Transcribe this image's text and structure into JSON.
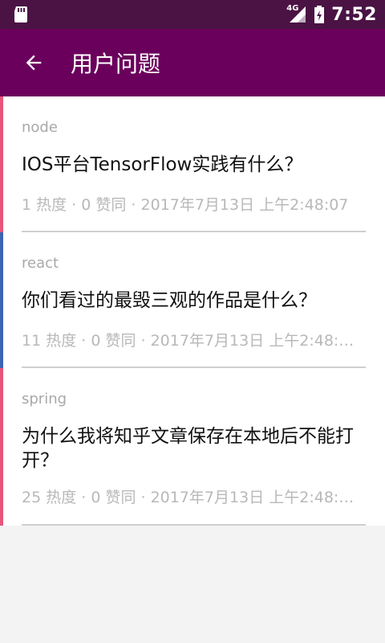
{
  "status": {
    "network": "4G",
    "time": "7:52"
  },
  "appbar": {
    "title": "用户问题",
    "back_icon": "arrow-back-icon"
  },
  "questions": [
    {
      "tag": "node",
      "title": "IOS平台TensorFlow实践有什么？",
      "meta": "1 热度 · 0 赞同 · 2017年7月13日 上午2:48:07",
      "accent": "#e8557a"
    },
    {
      "tag": "react",
      "title": "你们看过的最毁三观的作品是什么？",
      "meta": "11 热度 · 0 赞同 · 2017年7月13日 上午2:48:…",
      "accent": "#3b66b3"
    },
    {
      "tag": "spring",
      "title": "为什么我将知乎文章保存在本地后不能打开？",
      "meta": "25 热度 · 0 赞同 · 2017年7月13日 上午2:48:…",
      "accent": "#e8557a"
    }
  ],
  "colors": {
    "status_bar": "#4a1344",
    "app_bar": "#6b005c",
    "background": "#f3f3f3"
  }
}
